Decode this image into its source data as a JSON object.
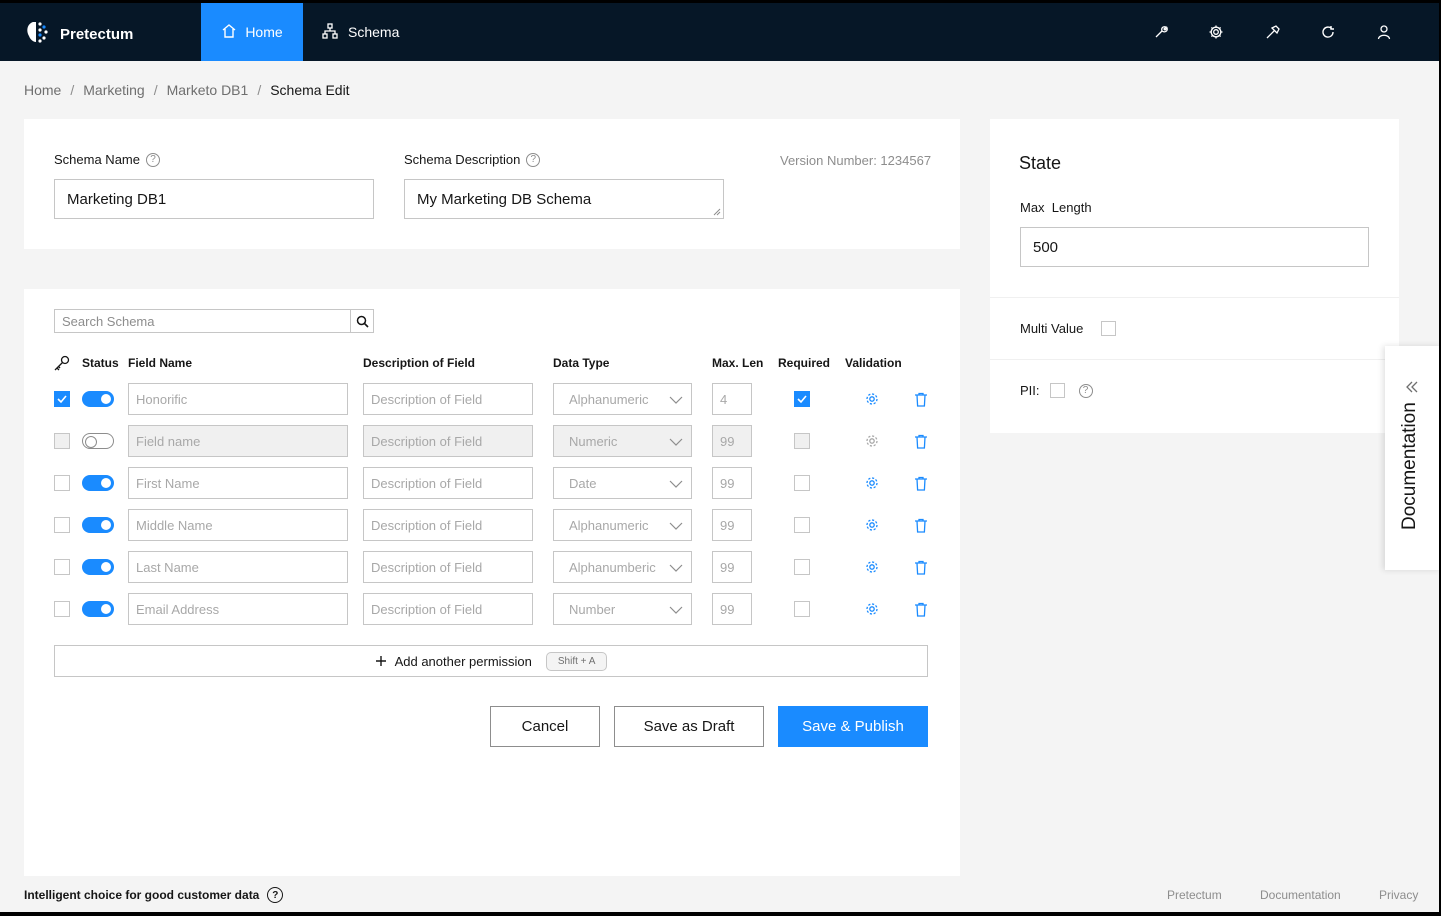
{
  "header": {
    "brand": "Pretectum",
    "nav": {
      "home": "Home",
      "schema": "Schema"
    },
    "icons": [
      "wrench-icon",
      "gear-icon",
      "hammer-icon",
      "refresh-icon",
      "user-icon"
    ]
  },
  "breadcrumb": [
    "Home",
    "Marketing",
    "Marketo DB1",
    "Schema Edit"
  ],
  "form": {
    "schema_name_label": "Schema Name",
    "schema_name_value": "Marketing DB1",
    "schema_desc_label": "Schema Description",
    "schema_desc_value": "My Marketing DB Schema",
    "version": "Version Number: 1234567"
  },
  "search": {
    "placeholder": "Search Schema"
  },
  "table": {
    "headers": {
      "status": "Status",
      "field_name": "Field Name",
      "description": "Description of Field",
      "data_type": "Data Type",
      "max_len": "Max. Len",
      "required": "Required",
      "validation": "Validation"
    },
    "rows": [
      {
        "checked": true,
        "enabled": true,
        "field": "Honorific",
        "desc": "Description of Field",
        "type": "Alphanumeric",
        "len": "4",
        "required": true
      },
      {
        "checked": false,
        "enabled": false,
        "field": "Field name",
        "desc": "Description of Field",
        "type": "Numeric",
        "len": "99",
        "required": false
      },
      {
        "checked": false,
        "enabled": true,
        "field": "First Name",
        "desc": "Description of Field",
        "type": "Date",
        "len": "99",
        "required": false
      },
      {
        "checked": false,
        "enabled": true,
        "field": "Middle Name",
        "desc": "Description of Field",
        "type": "Alphanumeric",
        "len": "99",
        "required": false
      },
      {
        "checked": false,
        "enabled": true,
        "field": "Last Name",
        "desc": "Description of Field",
        "type": "Alphanumberic",
        "len": "99",
        "required": false
      },
      {
        "checked": false,
        "enabled": true,
        "field": "Email Address",
        "desc": "Description of Field",
        "type": "Number",
        "len": "99",
        "required": false
      }
    ]
  },
  "add_permission": {
    "label": "Add another permission",
    "shortcut": "Shift + A"
  },
  "actions": {
    "cancel": "Cancel",
    "draft": "Save as Draft",
    "publish": "Save & Publish"
  },
  "side": {
    "title": "State",
    "max_length_label": "Max  Length",
    "max_length_value": "500",
    "multi_value_label": "Multi Value",
    "pii_label": "PII:"
  },
  "documentation_tab": "Documentation",
  "footer": {
    "tagline": "Intelligent choice for good customer data",
    "links": [
      "Pretectum",
      "Documentation",
      "Privacy"
    ]
  },
  "colors": {
    "accent": "#1a8bff",
    "topbar": "#061727"
  }
}
